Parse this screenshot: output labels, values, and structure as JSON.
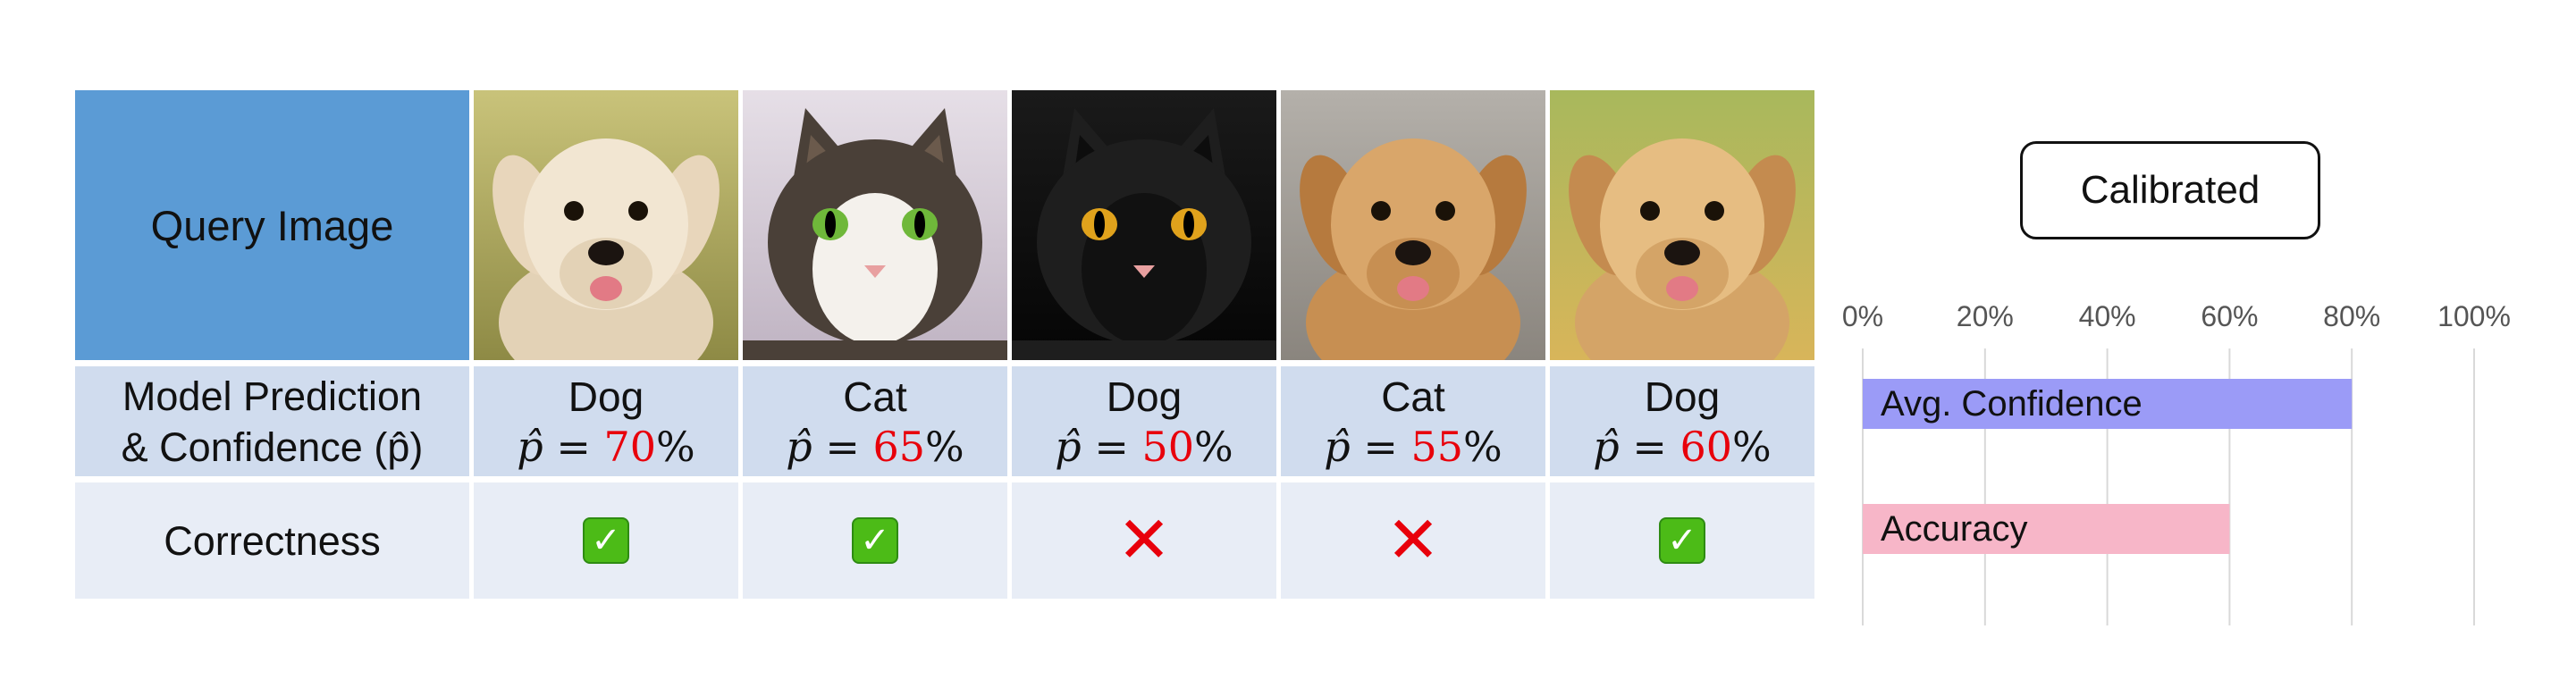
{
  "table": {
    "header_label": "Query Image",
    "prediction_label_line1": "Model Prediction",
    "prediction_label_line2": "& Confidence (p̂)",
    "correctness_label": "Correctness",
    "columns": [
      {
        "image": "dog",
        "pred": "Dog",
        "conf_prefix": "p̂ = ",
        "conf_num": "70",
        "conf_suffix": "%",
        "correct": true
      },
      {
        "image": "cat",
        "pred": "Cat",
        "conf_prefix": "p̂ = ",
        "conf_num": "65",
        "conf_suffix": "%",
        "correct": true
      },
      {
        "image": "cat",
        "pred": "Dog",
        "conf_prefix": "p̂ = ",
        "conf_num": "50",
        "conf_suffix": "%",
        "correct": false
      },
      {
        "image": "dog",
        "pred": "Cat",
        "conf_prefix": "p̂ = ",
        "conf_num": "55",
        "conf_suffix": "%",
        "correct": false
      },
      {
        "image": "dog",
        "pred": "Dog",
        "conf_prefix": "p̂ = ",
        "conf_num": "60",
        "conf_suffix": "%",
        "correct": true
      }
    ],
    "check_glyph": "✓",
    "cross_glyph": "✕"
  },
  "calibration_label": "Calibrated",
  "chart_data": {
    "type": "bar",
    "orientation": "horizontal",
    "ticks": [
      "0%",
      "20%",
      "40%",
      "60%",
      "80%",
      "100%"
    ],
    "xlim": [
      0,
      100
    ],
    "grid": true,
    "series": [
      {
        "name": "Avg. Confidence",
        "value": 80,
        "color": "#9b9bf7"
      },
      {
        "name": "Accuracy",
        "value": 60,
        "color": "#f7b6c8"
      }
    ]
  },
  "colors": {
    "header": "#5b9bd5",
    "prediction_row": "#d0dcee",
    "correctness_row": "#e8edf6",
    "confidence_number": "#e8000b",
    "check": "#4cbb17",
    "cross": "#e8000b"
  }
}
